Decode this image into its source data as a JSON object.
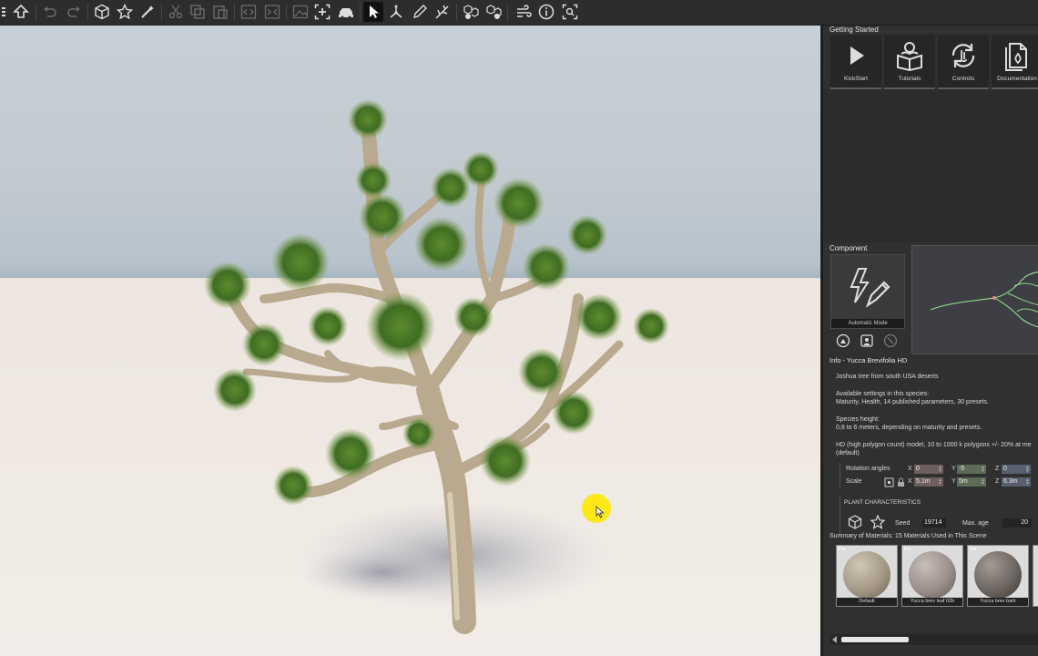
{
  "toolbar": {
    "icons": [
      "menu-icon",
      "upload-icon",
      "undo-icon",
      "redo-icon",
      "cube-icon",
      "star-icon",
      "wand-icon",
      "cut-icon",
      "copy-icon",
      "paste-icon",
      "code-in-icon",
      "code-out-icon",
      "image-icon",
      "frame-plus-icon",
      "car-icon",
      "select-arrow-icon",
      "move-node-icon",
      "pencil-icon",
      "branch-icon",
      "cubes-add-icon",
      "cubes-remove-icon",
      "wind-icon",
      "info-icon",
      "zoom-fit-icon"
    ]
  },
  "getting_started": {
    "title": "Getting Started",
    "buttons": [
      {
        "label": "KickStart",
        "icon": "play-icon"
      },
      {
        "label": "Tutorials",
        "icon": "reader-icon"
      },
      {
        "label": "Controls",
        "icon": "refresh-hand-icon"
      },
      {
        "label": "Documentation",
        "icon": "document-icon"
      }
    ]
  },
  "component": {
    "title": "Component",
    "mode_label": "Automatic Mode"
  },
  "info": {
    "title": "Info - Yucca Brevifolia HD",
    "lines": [
      "Joshua tree from south USA deserts",
      "Available settings in this species:",
      "Maturity, Health, 14 published parameters, 30 presets.",
      "Species height:",
      "0,8 to 6 meters, depending on maturity and presets.",
      "HD (high polygon count) model, 10  to 1000 k polygons +/- 20% at me",
      "(default)"
    ]
  },
  "params": {
    "rotation_label": "Rotation angles",
    "scale_label": "Scale",
    "x_axis": "X",
    "y_axis": "Y",
    "z_axis": "Z",
    "rot_x": "0",
    "rot_y": "-5",
    "rot_z": "0",
    "scale_x": "5.1m",
    "scale_y": "5m",
    "scale_z": "6.3m"
  },
  "plant": {
    "title": "PLANT CHARACTERISTICS",
    "seed_label": "Seed",
    "seed_value": "19714",
    "max_age_label": "Max. age",
    "max_age_value": "20"
  },
  "materials": {
    "summary": "Summary of Materials: 15 Materials Used in This Scene",
    "tag": "Par",
    "items": [
      {
        "name": "Default",
        "color": "#a59986"
      },
      {
        "name": "Yucca brev leaf 02b",
        "color": "#9a8f8b"
      },
      {
        "name": "Yucca brev bark",
        "color": "#6d6661"
      }
    ]
  }
}
